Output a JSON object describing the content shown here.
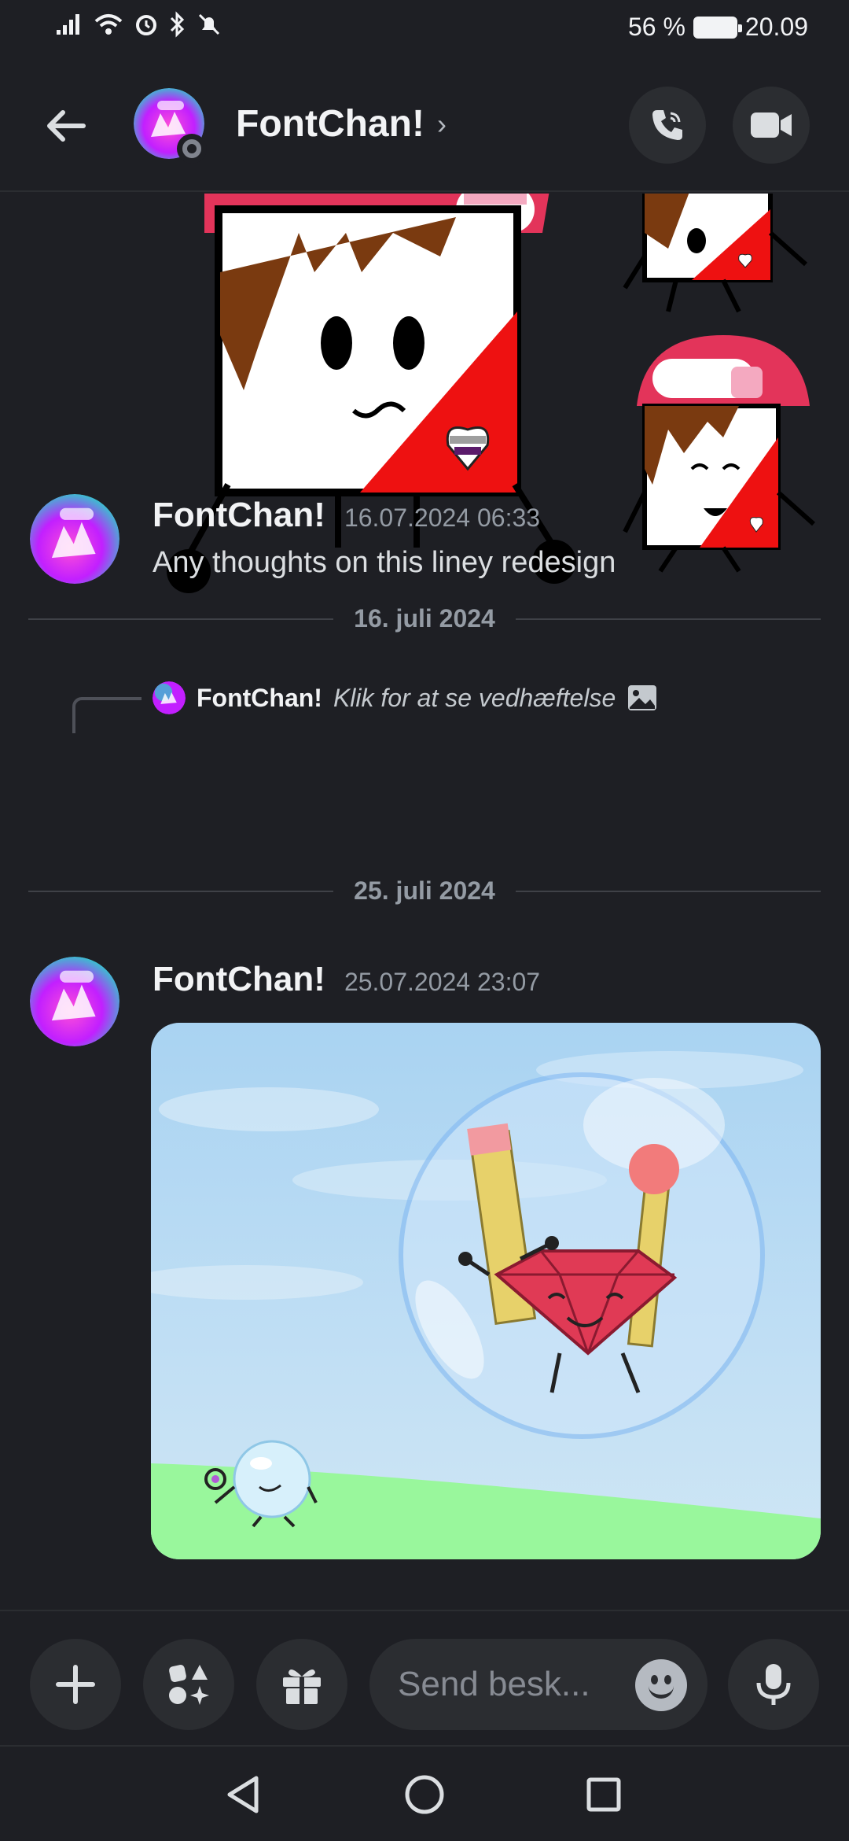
{
  "status_bar": {
    "battery_percent": "56 %",
    "time": "20.09"
  },
  "header": {
    "title": "FontChan!",
    "chevron": "›"
  },
  "messages": [
    {
      "date_divider": "16. juli 2024",
      "reply": {
        "author": "FontChan!",
        "text": "Klik for at se vedhæftelse"
      },
      "author": "FontChan!",
      "timestamp": "16.07.2024 06:33",
      "text": "Any thoughts on this liney redesign"
    },
    {
      "date_divider": "25. juli 2024",
      "author": "FontChan!",
      "timestamp": "25.07.2024 23:07"
    }
  ],
  "composer": {
    "placeholder": "Send besk..."
  },
  "icons": {
    "back": "arrow-left-icon",
    "call": "phone-icon",
    "video": "video-camera-icon",
    "plus": "plus-icon",
    "apps": "apps-icon",
    "gift": "gift-icon",
    "emoji": "emoji-icon",
    "mic": "microphone-icon",
    "jump": "arrow-down-icon"
  },
  "colors": {
    "background": "#1e1f24",
    "surface": "#2b2d31",
    "text_primary": "#f2f3f5",
    "text_muted": "#949ba4"
  }
}
